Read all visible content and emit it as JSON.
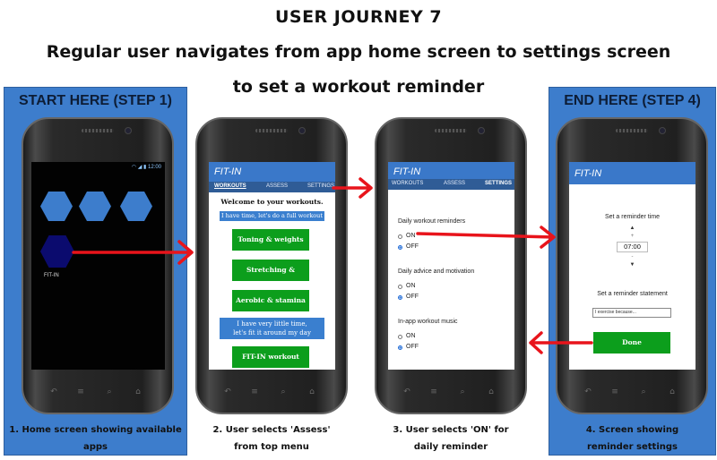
{
  "header": {
    "title": "USER JOURNEY 7",
    "subtitle_line1": "Regular user navigates from app home screen to settings screen",
    "subtitle_line2": "to set a workout reminder"
  },
  "panels": {
    "start_label": "START HERE (STEP 1)",
    "end_label": "END HERE (STEP 4)"
  },
  "captions": {
    "step1": "1. Home screen showing available apps",
    "step2_line1": "2. User selects 'Assess'",
    "step2_line2": "from top menu",
    "step3_line1": "3. User selects 'ON' for",
    "step3_line2": "daily reminder",
    "step4_line1": "4. Screen showing",
    "step4_line2": "reminder settings"
  },
  "screen1": {
    "status_time": "12:00",
    "app_label": "FIT-IN"
  },
  "screen2": {
    "app_title": "FIT-IN",
    "tabs": [
      "WORKOUTS",
      "ASSESS",
      "SETTINGS"
    ],
    "welcome": "Welcome to your workouts.",
    "have_time": "I have time, let's do a full workout",
    "btn_toning": "Toning & weights",
    "btn_stretching": "Stretching & mobility",
    "btn_aerobic": "Aerobic & stamina",
    "little_time_line1": "I have very little time,",
    "little_time_line2": "let's fit it around my day",
    "btn_fitin": "FIT-IN workout"
  },
  "screen3": {
    "app_title": "FIT-IN",
    "tabs": [
      "WORKOUTS",
      "ASSESS",
      "SETTINGS"
    ],
    "groups": [
      {
        "label": "Daily workout reminders",
        "on": "ON",
        "off": "OFF",
        "selected": "OFF"
      },
      {
        "label": "Daily advice and motivation",
        "on": "ON",
        "off": "OFF",
        "selected": "OFF"
      },
      {
        "label": "In-app workout music",
        "on": "ON",
        "off": "OFF",
        "selected": "OFF"
      }
    ]
  },
  "screen4": {
    "app_title": "FIT-IN",
    "reminder_time_label": "Set a reminder time",
    "plus": "+",
    "time_value": "07:00",
    "minus": "-",
    "statement_label": "Set a reminder statement",
    "statement_value": "I exercise because...",
    "done_label": "Done"
  },
  "colors": {
    "panel_blue": "#3d7dcc",
    "header_blue": "#3a78c9",
    "tab_blue": "#2f5c96",
    "button_green": "#0c9e1c",
    "hex_dark": "#0b0b6e",
    "arrow_red": "#e8141b"
  }
}
